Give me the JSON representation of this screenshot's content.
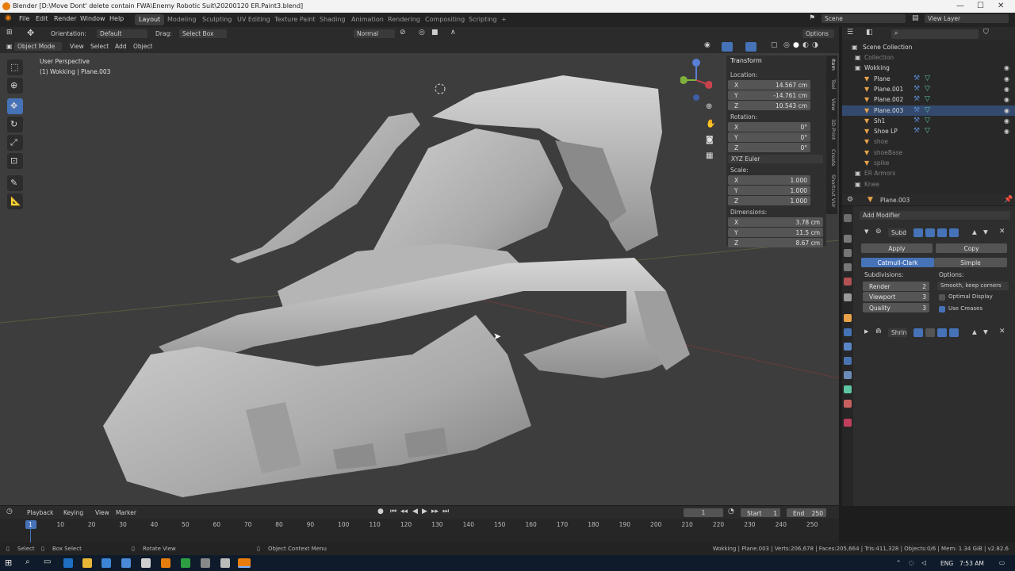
{
  "window": {
    "title": "Blender [D:\\Move Dont' delete contain FWA\\Enemy Robotic Suit\\20200120 ER.Paint3.blend]",
    "min": "—",
    "max": "☐",
    "close": "✕"
  },
  "menu": [
    "File",
    "Edit",
    "Render",
    "Window",
    "Help"
  ],
  "workspaces": [
    "Layout",
    "Modeling",
    "Sculpting",
    "UV Editing",
    "Texture Paint",
    "Shading",
    "Animation",
    "Rendering",
    "Compositing",
    "Scripting",
    "+"
  ],
  "scene": {
    "scene_label": "Scene",
    "view_layer": "View Layer"
  },
  "header": {
    "orientation_label": "Orientation:",
    "orientation_value": "Default",
    "drag_label": "Drag:",
    "drag_value": "Select Box",
    "normal": "Normal",
    "options": "Options"
  },
  "header2": {
    "mode": "Object Mode",
    "menus": [
      "View",
      "Select",
      "Add",
      "Object"
    ]
  },
  "viewport": {
    "perspective": "User Perspective",
    "context": "(1) Wokking | Plane.003"
  },
  "transform": {
    "title": "Transform",
    "location_label": "Location:",
    "location": [
      {
        "k": "X",
        "v": "14.567 cm"
      },
      {
        "k": "Y",
        "v": "-14.761 cm"
      },
      {
        "k": "Z",
        "v": "10.543 cm"
      }
    ],
    "rotation_label": "Rotation:",
    "rotation": [
      {
        "k": "X",
        "v": "0°"
      },
      {
        "k": "Y",
        "v": "0°"
      },
      {
        "k": "Z",
        "v": "0°"
      }
    ],
    "euler": "XYZ Euler",
    "scale_label": "Scale:",
    "scale": [
      {
        "k": "X",
        "v": "1.000"
      },
      {
        "k": "Y",
        "v": "1.000"
      },
      {
        "k": "Z",
        "v": "1.000"
      }
    ],
    "dimensions_label": "Dimensions:",
    "dimensions": [
      {
        "k": "X",
        "v": "3.78 cm"
      },
      {
        "k": "Y",
        "v": "11.5 cm"
      },
      {
        "k": "Z",
        "v": "8.67 cm"
      }
    ]
  },
  "sidetabs": [
    "Item",
    "Tool",
    "View",
    "3D-Print",
    "Create",
    "Shortcut VUr"
  ],
  "outliner": {
    "root": "Scene Collection",
    "rows": [
      {
        "name": "Collection",
        "dim": true,
        "indent": 0
      },
      {
        "name": "Wokking",
        "dim": false,
        "indent": 0
      },
      {
        "name": "Plane",
        "dim": false,
        "indent": 1
      },
      {
        "name": "Plane.001",
        "dim": false,
        "indent": 1
      },
      {
        "name": "Plane.002",
        "dim": false,
        "indent": 1
      },
      {
        "name": "Plane.003",
        "dim": false,
        "indent": 1
      },
      {
        "name": "Sh1",
        "dim": false,
        "indent": 1
      },
      {
        "name": "Shoe LP",
        "dim": false,
        "indent": 1
      },
      {
        "name": "shoe",
        "dim": true,
        "indent": 1
      },
      {
        "name": "shoeBase",
        "dim": true,
        "indent": 1
      },
      {
        "name": "spike",
        "dim": true,
        "indent": 1
      },
      {
        "name": "ER Armors",
        "dim": true,
        "indent": 0
      },
      {
        "name": "Knee",
        "dim": true,
        "indent": 0
      }
    ]
  },
  "properties": {
    "object": "Plane.003",
    "add_modifier": "Add Modifier",
    "mod1_name": "Subd",
    "apply": "Apply",
    "copy": "Copy",
    "catmull": "Catmull-Clark",
    "simple": "Simple",
    "subdivisions": "Subdivisions:",
    "options": "Options:",
    "render_label": "Render",
    "render_val": "2",
    "viewport_label": "Viewport",
    "viewport_val": "3",
    "quality_label": "Quality",
    "quality_val": "3",
    "uv_smooth": "Smooth, keep corners",
    "optimal": "Optimal Display",
    "creases": "Use Creases",
    "mod2_name": "Shrin"
  },
  "timeline": {
    "menus": [
      "Playback",
      "Keying",
      "View",
      "Marker"
    ],
    "current": "1",
    "start_label": "Start",
    "start": "1",
    "end_label": "End",
    "end": "250",
    "ticks": [
      "1",
      "10",
      "20",
      "30",
      "40",
      "50",
      "60",
      "70",
      "80",
      "90",
      "100",
      "110",
      "120",
      "130",
      "140",
      "150",
      "160",
      "170",
      "180",
      "190",
      "200",
      "210",
      "220",
      "230",
      "240",
      "250"
    ]
  },
  "status": {
    "select": "Select",
    "box_select": "Box Select",
    "rotate": "Rotate View",
    "context_menu": "Object Context Menu",
    "stats": "Wokking | Plane.003 | Verts:206,678 | Faces:205,664 | Tris:411,328 | Objects:0/6 | Mem: 1.34 GiB | v2.82.6"
  },
  "taskbar": {
    "lang": "ENG",
    "time": "7:53 AM"
  },
  "colors": {
    "accent": "#4672b8",
    "orange": "#e8a24a",
    "green": "#5fc6a4"
  }
}
